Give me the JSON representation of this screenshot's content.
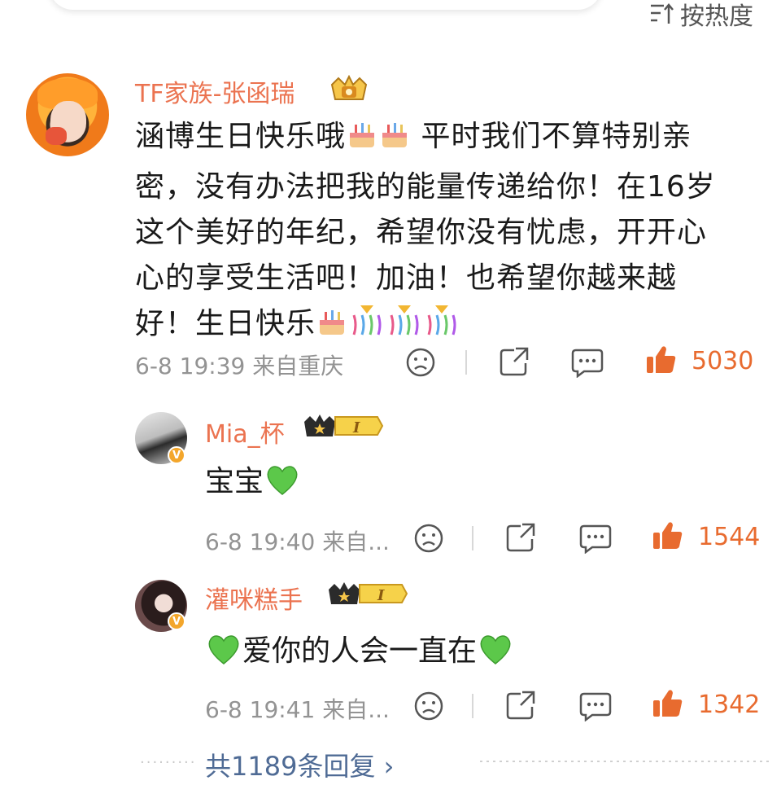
{
  "sort": {
    "label": "按热度",
    "icon": "sort-icon"
  },
  "comment": {
    "username": "TF家族-张函瑞",
    "badge": "crown-badge-icon",
    "lines": [
      "涵博生日快乐哦",
      "平时我们不算特别亲",
      "密，没有办法把我的能量传递给你！在16岁",
      "这个美好的年纪，希望你没有忧虑，开开心",
      "心的享受生活吧！加油！也希望你越来越",
      "好！生日快乐"
    ],
    "time": "6-8 19:39",
    "location": "来自重庆",
    "likes": "5030"
  },
  "replies": [
    {
      "username": "Mia_杯",
      "level": "I",
      "text": "宝宝",
      "time": "6-8 19:40",
      "location": "来自...",
      "likes": "1544",
      "verified": "V"
    },
    {
      "username": "灌咪糕手",
      "level": "I",
      "text": "爱你的人会一直在",
      "time": "6-8 19:41",
      "location": "来自...",
      "likes": "1342",
      "verified": "V"
    }
  ],
  "more_replies": "共1189条回复 ›",
  "colors": {
    "username": "#eb7350",
    "meta": "#939393",
    "like": "#e86b2f",
    "link": "#4f6b95"
  }
}
